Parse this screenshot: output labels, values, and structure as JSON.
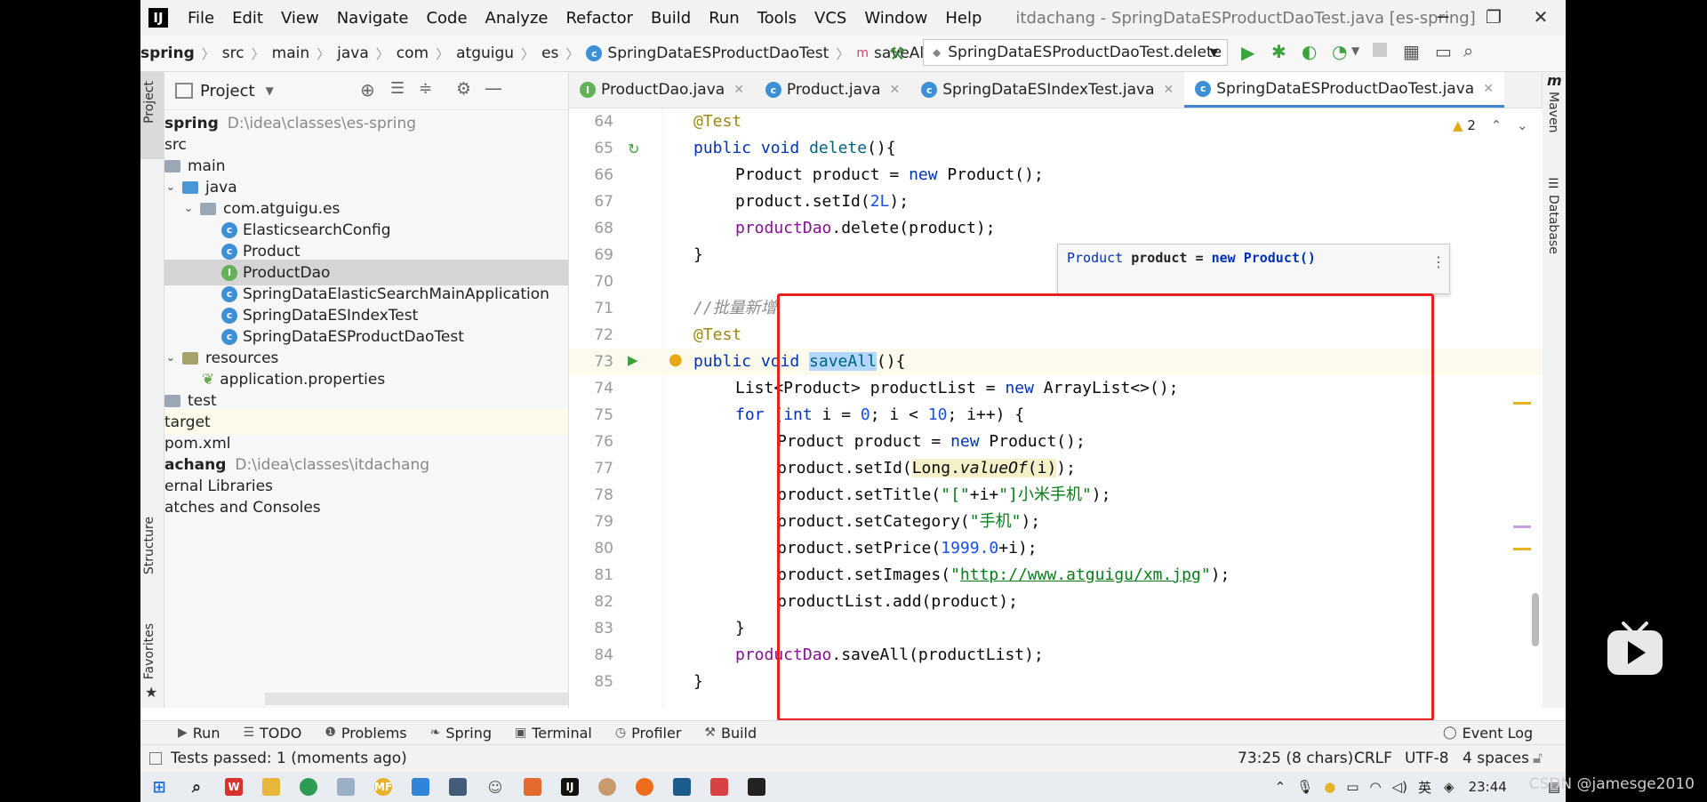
{
  "menu": {
    "items": [
      "File",
      "Edit",
      "View",
      "Navigate",
      "Code",
      "Analyze",
      "Refactor",
      "Build",
      "Run",
      "Tools",
      "VCS",
      "Window",
      "Help"
    ],
    "window_title": "itdachang - SpringDataESProductDaoTest.java [es-spring]"
  },
  "nav": {
    "crumbs": [
      "spring",
      "src",
      "main",
      "java",
      "com",
      "atguigu",
      "es",
      "SpringDataESProductDaoTest",
      "saveAll"
    ],
    "run_config": "SpringDataESProductDaoTest.delete"
  },
  "project": {
    "header": "Project",
    "tree": [
      {
        "label": "spring",
        "path": "D:\\idea\\classes\\es-spring"
      },
      {
        "label": "src"
      },
      {
        "label": "main"
      },
      {
        "label": "java"
      },
      {
        "label": "com.atguigu.es"
      },
      {
        "label": "ElasticsearchConfig"
      },
      {
        "label": "Product"
      },
      {
        "label": "ProductDao"
      },
      {
        "label": "SpringDataElasticSearchMainApplication"
      },
      {
        "label": "SpringDataESIndexTest"
      },
      {
        "label": "SpringDataESProductDaoTest"
      },
      {
        "label": "resources"
      },
      {
        "label": "application.properties"
      },
      {
        "label": "test"
      },
      {
        "label": "target"
      },
      {
        "label": "pom.xml"
      },
      {
        "label": "achang",
        "path": "D:\\idea\\classes\\itdachang"
      },
      {
        "label": "ernal Libraries"
      },
      {
        "label": "atches and Consoles"
      }
    ]
  },
  "left_stripe": {
    "project": "Project",
    "structure": "Structure",
    "favorites": "Favorites"
  },
  "right_stripe": {
    "maven": "Maven",
    "database": "Database"
  },
  "tabs": [
    "ProductDao.java",
    "Product.java",
    "SpringDataESIndexTest.java",
    "SpringDataESProductDaoTest.java"
  ],
  "editor": {
    "warnings": "2",
    "line_numbers": [
      "64",
      "65",
      "66",
      "67",
      "68",
      "69",
      "70",
      "71",
      "72",
      "73",
      "74",
      "75",
      "76",
      "77",
      "78",
      "79",
      "80",
      "81",
      "82",
      "83",
      "84",
      "85"
    ],
    "hint": {
      "type": "Product",
      "text": " product = ",
      "kw": "new",
      "ctor": "Product()"
    }
  },
  "code": {
    "l64": "@Test",
    "l65_a": "public void",
    "l65_b": "delete",
    "l65_c": "(){",
    "l66_a": "Product product = ",
    "l66_b": "new",
    "l66_c": " Product();",
    "l67_a": "product.setId(",
    "l67_b": "2L",
    "l67_c": ");",
    "l68_a": "productDao",
    "l68_b": ".delete(product);",
    "l69": "}",
    "l71": "//批量新增",
    "l72": "@Test",
    "l73_a": "public void ",
    "l73_b": "saveAll",
    "l73_c": "(){",
    "l74_a": "List<Product> productList = ",
    "l74_b": "new",
    "l74_c": " ArrayList<>();",
    "l75_a": "for",
    "l75_b": " (",
    "l75_c": "int",
    "l75_d": " i = ",
    "l75_e": "0",
    "l75_f": "; i < ",
    "l75_g": "10",
    "l75_h": "; i++) {",
    "l76_a": "Product product = ",
    "l76_b": "new",
    "l76_c": " Product();",
    "l77_a": "product.setId(",
    "l77_b": "Long.",
    "l77_c": "valueOf",
    "l77_d": "(i)",
    "l77_e": ");",
    "l78_a": "product.setTitle(",
    "l78_b": "\"[\"",
    "l78_c": "+i+",
    "l78_d": "\"]小米手机\"",
    "l78_e": ");",
    "l79_a": "product.setCategory(",
    "l79_b": "\"手机\"",
    "l79_c": ");",
    "l80_a": "product.setPrice(",
    "l80_b": "1999.0",
    "l80_c": "+i);",
    "l81_a": "product.setImages(",
    "l81_b": "\"",
    "l81_c": "http://www.atguigu/xm.jpg",
    "l81_d": "\"",
    "l81_e": ");",
    "l82": "productList.add(product);",
    "l83": "}",
    "l84_a": "productDao",
    "l84_b": ".saveAll(productList);",
    "l85": "}"
  },
  "tool_windows": [
    "Run",
    "TODO",
    "Problems",
    "Spring",
    "Terminal",
    "Profiler",
    "Build"
  ],
  "event_log": "Event Log",
  "status": {
    "message": "Tests passed: 1 (moments ago)",
    "position": "73:25 (8 chars)",
    "line_sep": "CRLF",
    "encoding": "UTF-8",
    "indent": "4 spaces"
  },
  "taskbar": {
    "ime": "英",
    "time": "23:44"
  },
  "watermark": "CSDN @jamesge2010",
  "colors": {
    "keyword": "#0033b3",
    "annotation": "#9e880d",
    "string": "#067d17",
    "field": "#871094",
    "highlight_box": "#e52121",
    "tab_active": "#4083c9"
  }
}
